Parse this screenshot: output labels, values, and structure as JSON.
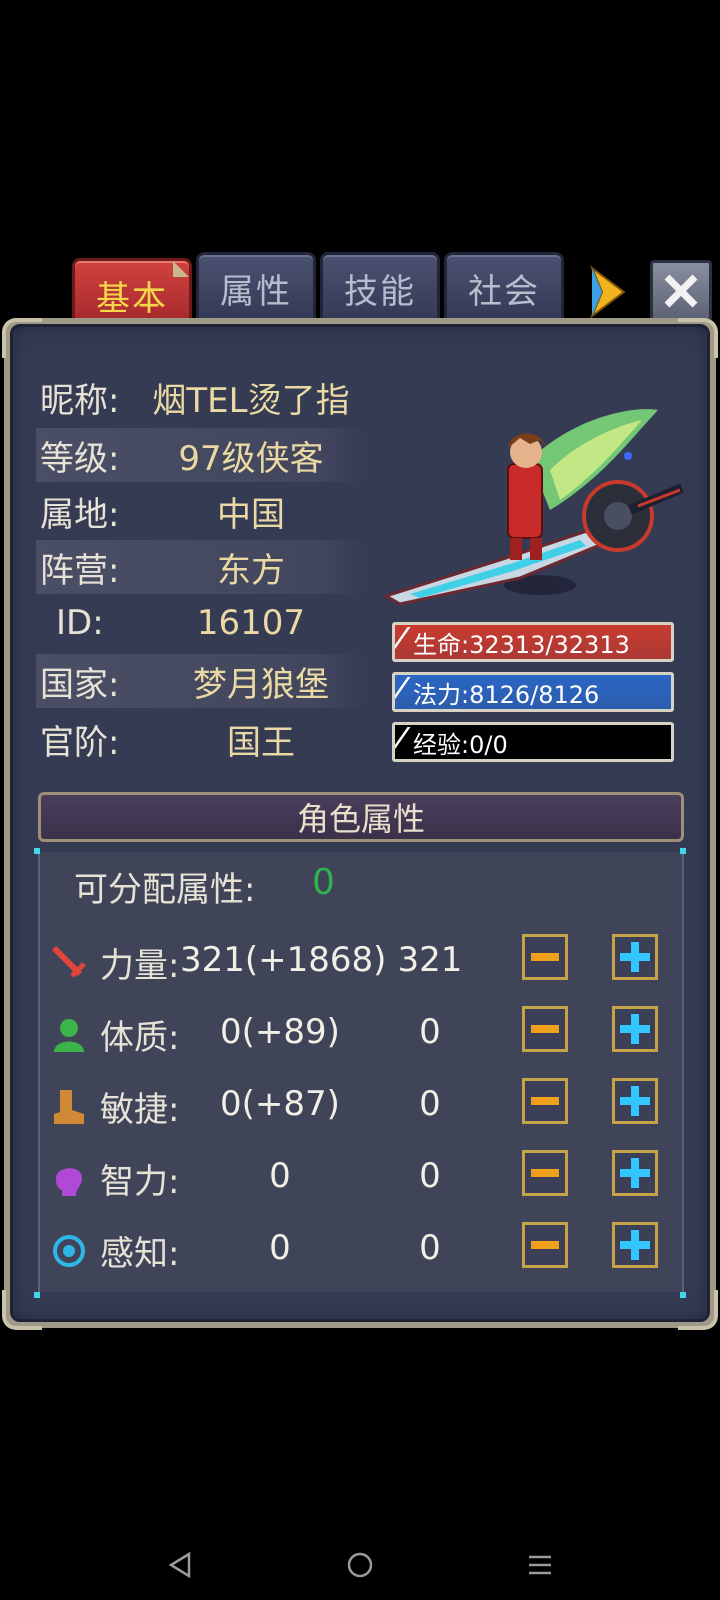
{
  "tabs": [
    {
      "label": "基本",
      "active": true
    },
    {
      "label": "属性",
      "active": false
    },
    {
      "label": "技能",
      "active": false
    },
    {
      "label": "社会",
      "active": false
    }
  ],
  "info": {
    "nickname": {
      "label": "昵称:",
      "value": "烟TEL烫了指"
    },
    "level": {
      "label": "等级:",
      "value": "97级侠客"
    },
    "region": {
      "label": "属地:",
      "value": "中国"
    },
    "camp": {
      "label": "阵营:",
      "value": "东方"
    },
    "id": {
      "label": "ID:",
      "value": "16107"
    },
    "country": {
      "label": "国家:",
      "value": "梦月狼堡"
    },
    "rank": {
      "label": "官阶:",
      "value": "国王"
    }
  },
  "bars": {
    "hp": {
      "text": "生命:32313/32313",
      "fraction": 1.0,
      "color": "#c83a2e"
    },
    "mp": {
      "text": "法力:8126/8126",
      "fraction": 1.0,
      "color": "#2a66c4"
    },
    "exp": {
      "text": "经验:0/0",
      "fraction": 0.0,
      "color": "#000000"
    }
  },
  "attributes": {
    "header": "角色属性",
    "allocatable_label": "可分配属性:",
    "allocatable_value": "0",
    "stats": [
      {
        "label": "力量:",
        "total": "321(+1868)",
        "base": "321",
        "icon": "sword-icon",
        "color": "#e0453a"
      },
      {
        "label": "体质:",
        "total": "0(+89)",
        "base": "0",
        "icon": "person-icon",
        "color": "#3cb44a"
      },
      {
        "label": "敏捷:",
        "total": "0(+87)",
        "base": "0",
        "icon": "boot-icon",
        "color": "#d08a36"
      },
      {
        "label": "智力:",
        "total": "0",
        "base": "0",
        "icon": "head-icon",
        "color": "#b04ad6"
      },
      {
        "label": "感知:",
        "total": "0",
        "base": "0",
        "icon": "eye-target-icon",
        "color": "#2fb6e6"
      }
    ]
  }
}
